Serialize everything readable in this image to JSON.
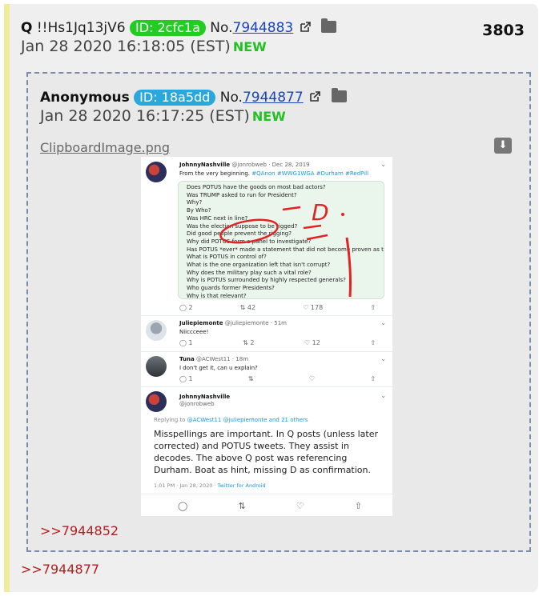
{
  "outer": {
    "name": "Q",
    "trip": "!!Hs1Jq13jV6",
    "id_label": "ID: 2cfc1a",
    "no_prefix": "No.",
    "post_number": "7944883",
    "date": "Jan 28 2020 16:18:05 (EST)",
    "new_badge": "NEW",
    "post_count": "3803",
    "backlink": ">>7944877"
  },
  "quoted": {
    "name": "Anonymous",
    "id_label": "ID: 18a5dd",
    "no_prefix": "No.",
    "post_number": "7944877",
    "date": "Jan 28 2020 16:17:25 (EST)",
    "new_badge": "NEW",
    "file_name": "ClipboardImage.png",
    "backlink": ">>7944852"
  },
  "screenshot": {
    "tweet1": {
      "name": "JohnnyNashville",
      "handle": "@jonrobweb · Dec 28, 2019",
      "text_prefix": "From the very beginning.",
      "hashtags": "#QAnon #WWG1WGA #Durham #RedPill",
      "quote_lines": [
        "Does POTUS have the goods on most bad actors?",
        "Was TRUMP asked to run for President?",
        "Why?",
        "By Who?",
        "Was HRC next in line?",
        "Was the election suppose to be rigged?",
        "Did good people prevent the rigging?",
        "Why did POTUS form a panel to investigate?",
        "Has POTUS *ever* made a statement that did not become proven as true/fact?",
        "What is POTUS in control of?",
        "What is the one organization left that isn't corrupt?",
        "Why does the military play such a vital role?",
        "Why is POTUS surrounded by highly respected generals?",
        "Who guards former Presidents?",
        "Why is that relevant?"
      ],
      "replies": "2",
      "retweets": "42",
      "likes": "178"
    },
    "tweet2": {
      "name": "Juliepiemonte",
      "handle": "@juliepiemonte · 51m",
      "text": "Niiccceee!",
      "replies": "1",
      "retweets": "2",
      "likes": "12"
    },
    "tweet3": {
      "name": "Tuna",
      "handle": "@ACWest11 · 18m",
      "text": "I don't get it, can u explain?",
      "replies": "1",
      "retweets": "",
      "likes": ""
    },
    "tweet4": {
      "name": "JohnnyNashville",
      "handle": "@jonrobweb",
      "reply_prefix": "Replying to",
      "reply_to": "@ACWest11 @juliepiemonte and 21 others",
      "text": "Misspellings are important. In Q posts (unless later corrected) and POTUS tweets. They assist in decodes. The above Q post was referencing Durham. Boat as hint, missing D as confirmation.",
      "meta_time": "1:01 PM · Jan 28, 2020 ·",
      "meta_source": "Twitter for Android"
    },
    "annotation": "D"
  },
  "colors": {
    "post_bg": "#efefef",
    "quote_border": "#7a8ca8",
    "id_green": "#22cc22",
    "id_blue": "#2aa7dd",
    "new_green": "#24c024",
    "backlink_red": "#b01f1f",
    "link_blue": "#1a44b8",
    "ink_red": "#e02424"
  },
  "icons": [
    "external-link-icon",
    "folder-icon",
    "download-icon",
    "reply-icon",
    "retweet-icon",
    "like-icon",
    "share-icon",
    "chevron-down-icon"
  ]
}
